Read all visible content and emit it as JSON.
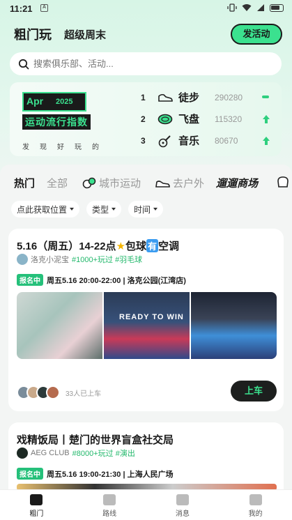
{
  "status_bar": {
    "time": "11:21",
    "notif_letter": "A"
  },
  "header": {
    "tab_active": "粗门玩",
    "tab_second": "超级周末",
    "cta_label": "发活动"
  },
  "search": {
    "placeholder": "搜索俱乐部、活动..."
  },
  "rank_card": {
    "badge_month": "Apr",
    "badge_year": "2025",
    "badge_title": "运动流行指数",
    "badge_sub": "发现好玩的",
    "items": [
      {
        "rank": "1",
        "name": "徒步",
        "score": "290280",
        "trend": "flat"
      },
      {
        "rank": "2",
        "name": "飞盘",
        "score": "115320",
        "trend": "up"
      },
      {
        "rank": "3",
        "name": "音乐",
        "score": "80670",
        "trend": "up"
      }
    ]
  },
  "categories": [
    "热门",
    "全部",
    "城市运动",
    "去户外",
    "遛遛商场"
  ],
  "filters": [
    "点此获取位置",
    "类型",
    "时间"
  ],
  "events": [
    {
      "title_pre": "5.16（周五）14-22点",
      "title_star": "★",
      "title_mid": "包球",
      "title_hl": "有",
      "title_post": "空调",
      "org": "洛克小泥宝",
      "tags": "#1000+玩过 #羽毛球",
      "status": "报名中",
      "info": "周五5.16 20:00-22:00 | 洛克公园(江湾店)",
      "photo2_text": "READY TO WIN",
      "participants": "33人已上车",
      "join_label": "上车"
    },
    {
      "title": "戏精饭局丨楚门的世界盲盒社交局",
      "org": "AEG CLUB",
      "tags": "#8000+玩过 #演出",
      "status": "报名中",
      "info": "周五5.16 19:00-21:30 | 上海人民广场"
    }
  ],
  "tabbar": [
    "粗门",
    "路线",
    "消息",
    "我的"
  ],
  "colors": {
    "accent": "#3be18f",
    "dark": "#1a1a1a",
    "tag_green": "#22b86b"
  }
}
